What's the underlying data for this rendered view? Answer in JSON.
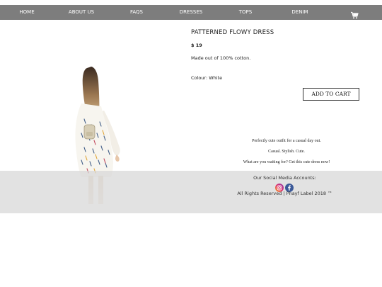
{
  "nav": {
    "items": [
      "HOME",
      "ABOUT US",
      "FAQS",
      "DRESSES",
      "TOPS",
      "DENIM"
    ],
    "cart_icon": "shopping-cart-icon",
    "background": "#7d7d7d",
    "text_color": "#ffffff"
  },
  "product": {
    "title": "PATTERNED FLOWY DRESS",
    "price": "$ 19",
    "description": "Made out of 100% cotton.",
    "colour": "Colour: White",
    "add_to_cart_label": "ADD TO CART"
  },
  "tagline": {
    "line1": "Perfectly cute outfit for a casual day out.",
    "line2": "Casual. Stylish. Cute.",
    "line3": "What are you waiting for? Get this cute dress now!"
  },
  "footer": {
    "heading": "Our Social Media Accounts:",
    "social_icons": [
      "instagram-icon",
      "facebook-icon"
    ],
    "rights": "All Rights Reserved | Phayf Label 2018 ™"
  }
}
